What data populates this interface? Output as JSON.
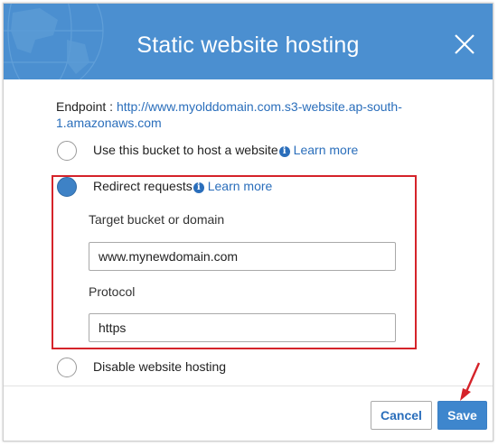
{
  "dialog": {
    "title": "Static website hosting"
  },
  "endpoint": {
    "label": "Endpoint :",
    "url": "http://www.myolddomain.com.s3-website.ap-south-1.amazonaws.com"
  },
  "options": {
    "host": {
      "label": "Use this bucket to host a website",
      "learn_more": "Learn more",
      "selected": false
    },
    "redirect": {
      "label": "Redirect requests",
      "learn_more": "Learn more",
      "selected": true
    },
    "disable": {
      "label": "Disable website hosting",
      "selected": false
    }
  },
  "redirect_form": {
    "target_label": "Target bucket or domain",
    "target_value": "www.mynewdomain.com",
    "protocol_label": "Protocol",
    "protocol_value": "https"
  },
  "buttons": {
    "cancel": "Cancel",
    "save": "Save"
  },
  "colors": {
    "header": "#4b8fd0",
    "link": "#2a6ebb",
    "highlight": "#d5232a",
    "primary": "#3e86cd"
  }
}
